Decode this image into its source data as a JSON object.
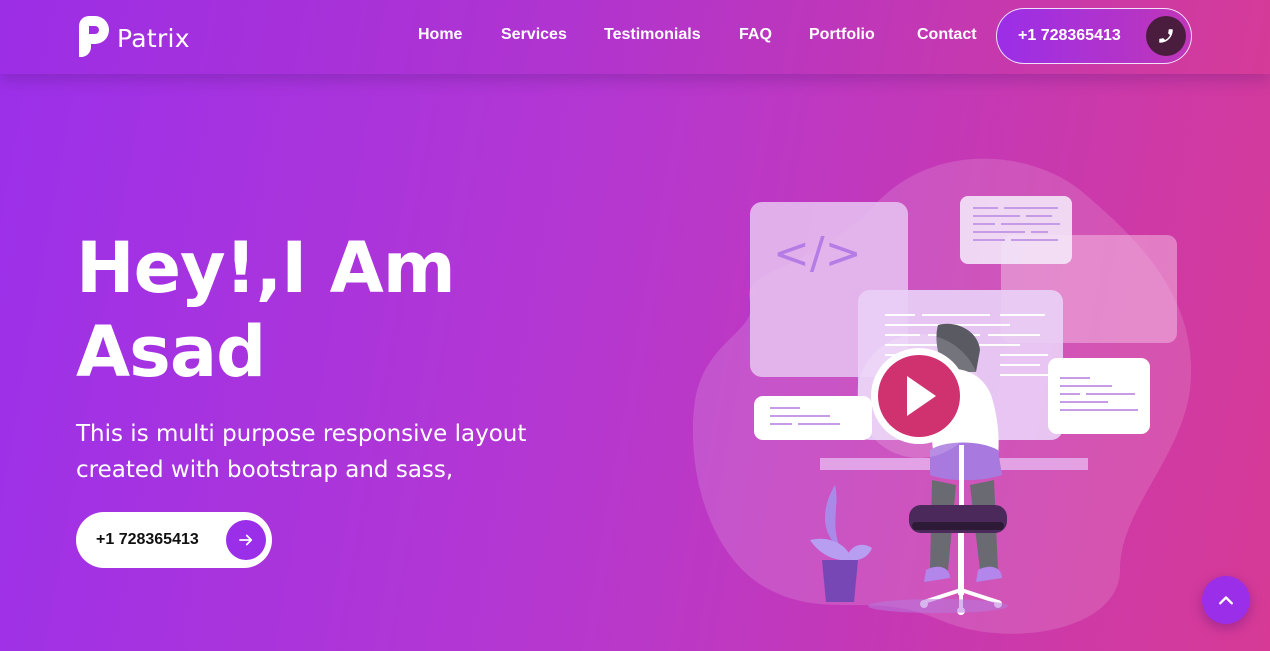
{
  "brand": {
    "name": "Patrix"
  },
  "nav": {
    "items": [
      {
        "label": "Home"
      },
      {
        "label": "Services"
      },
      {
        "label": "Testimonials"
      },
      {
        "label": "FAQ"
      },
      {
        "label": "Portfolio"
      },
      {
        "label": "Contact"
      }
    ],
    "phone": "+1 728365413",
    "phone_icon": "phone-icon"
  },
  "hero": {
    "title_line1": "Hey!,I Am",
    "title_line2": "Asad",
    "subtitle_line1": "This is multi purpose responsive layout",
    "subtitle_line2": "created with bootstrap and sass,",
    "cta_label": "+1 728365413",
    "cta_icon": "arrow-right-icon"
  },
  "illustration": {
    "code_symbol": "</>",
    "play_icon": "play-icon"
  },
  "scroll_top": {
    "icon": "chevron-up-icon"
  },
  "colors": {
    "gradient_start": "#9b30ea",
    "gradient_end": "#d73a96",
    "accent": "#9b2ee8",
    "play": "#d0316f"
  }
}
